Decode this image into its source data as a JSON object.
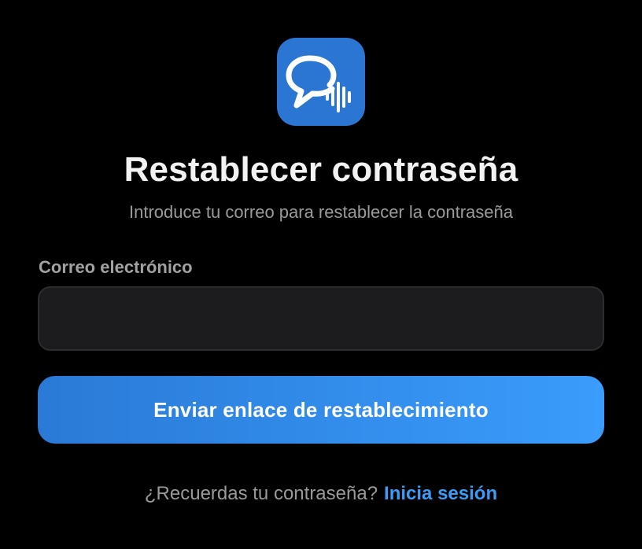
{
  "app": {
    "icon": "chat-bubble-soundwave-icon",
    "icon_color": "#2a76d2"
  },
  "header": {
    "title": "Restablecer contraseña",
    "subtitle": "Introduce tu correo para restablecer la contraseña"
  },
  "form": {
    "email_label": "Correo electrónico",
    "email_value": "",
    "email_placeholder": "",
    "submit_label": "Enviar enlace de restablecimiento",
    "button_gradient": [
      "#2a7ad6",
      "#3a9cfc"
    ]
  },
  "footer": {
    "prompt": "¿Recuerdas tu contraseña?",
    "link_label": "Inicia sesión",
    "link_color": "#3a9cf6"
  }
}
